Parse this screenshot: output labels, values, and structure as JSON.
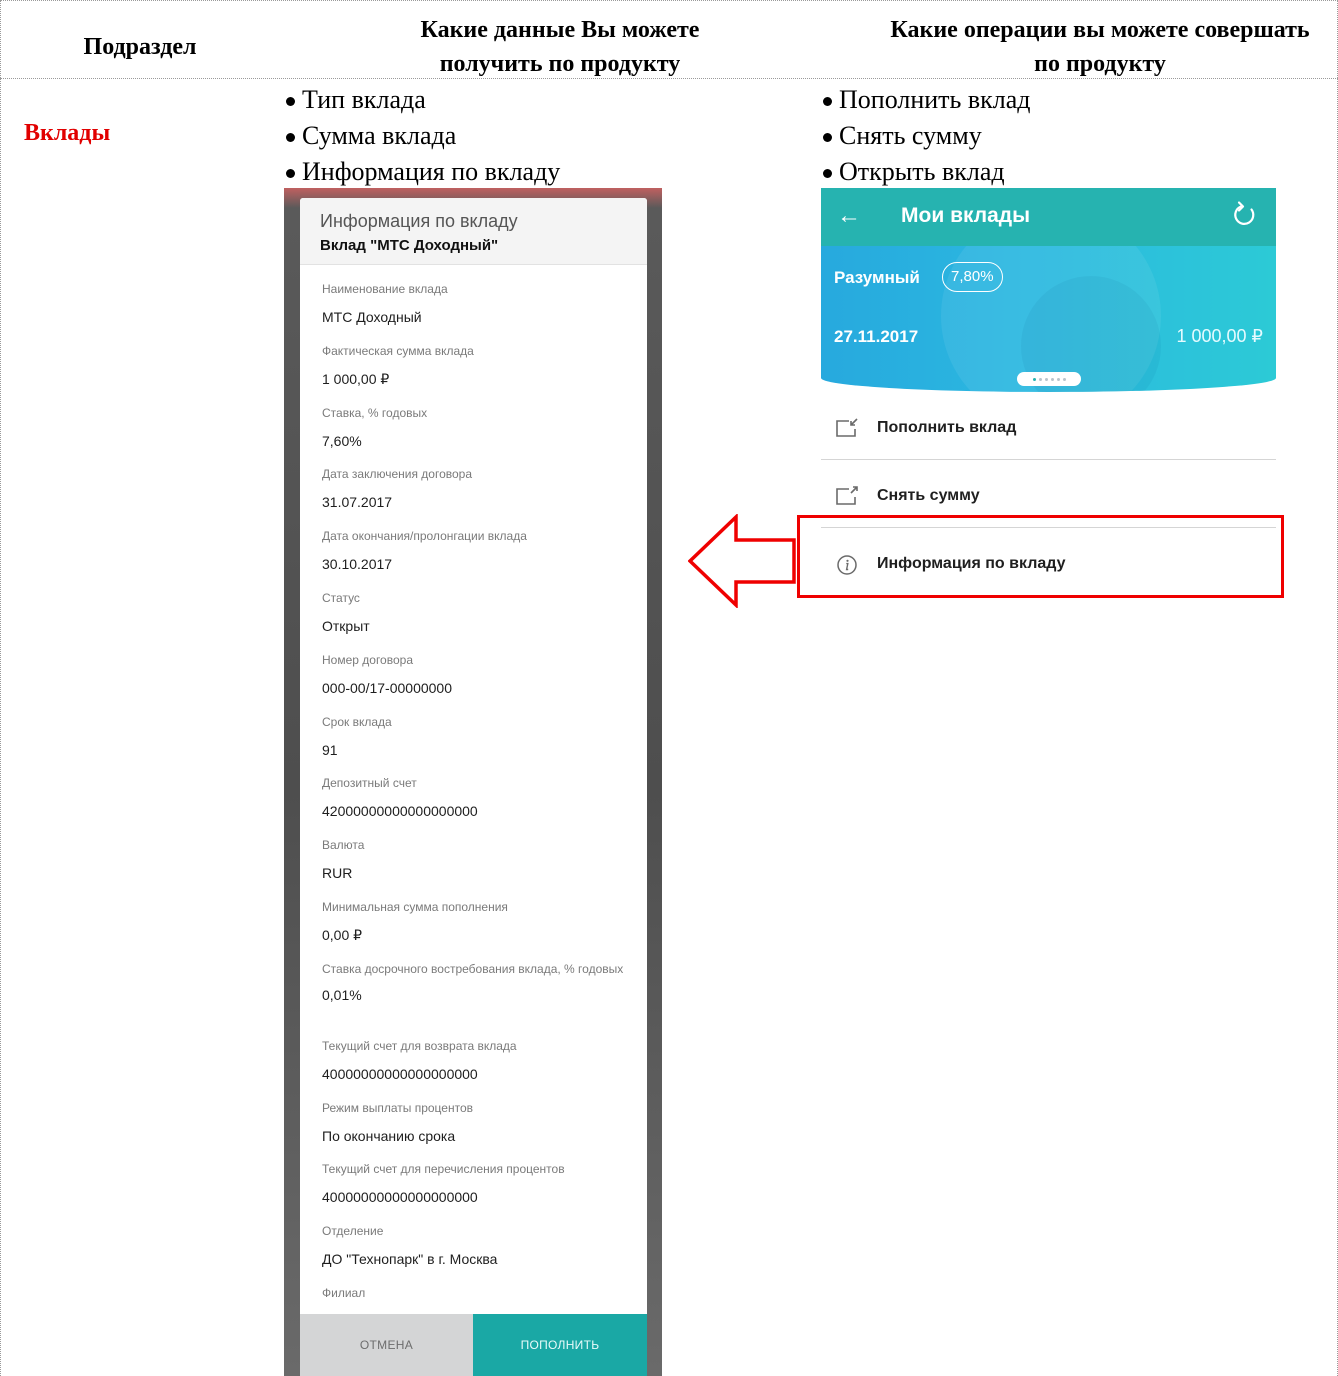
{
  "table": {
    "col1_header": "Подраздел",
    "col2_header": "Какие данные Вы можете получить по продукту",
    "col3_header": "Какие операции вы можете совершать по продукту",
    "section_name": "Вклады",
    "data_items": [
      "Тип вклада",
      "Сумма вклада",
      "Информация по вкладу"
    ],
    "operation_items": [
      "Пополнить вклад",
      "Снять сумму",
      "Открыть вклад"
    ]
  },
  "dialog": {
    "title": "Информация по вкладу",
    "subtitle": "Вклад \"МТС Доходный\"",
    "fields": [
      {
        "label": "Наименование вклада",
        "value": "МТС Доходный"
      },
      {
        "label": "Фактическая сумма вклада",
        "value": "1 000,00 ₽"
      },
      {
        "label": "Ставка, % годовых",
        "value": "7,60%"
      },
      {
        "label": "Дата заключения договора",
        "value": "31.07.2017"
      },
      {
        "label": "Дата окончания/пролонгации вклада",
        "value": "30.10.2017"
      },
      {
        "label": "Статус",
        "value": "Открыт"
      },
      {
        "label": "Номер договора",
        "value": "000-00/17-00000000"
      },
      {
        "label": "Срок вклада",
        "value": "91"
      },
      {
        "label": "Депозитный счет",
        "value": "42000000000000000000"
      },
      {
        "label": "Валюта",
        "value": "RUR"
      },
      {
        "label": "Минимальная сумма пополнения",
        "value": "0,00 ₽"
      },
      {
        "label": "Ставка досрочного востребования вклада, % годовых",
        "value": "0,01%"
      },
      {
        "label": "Текущий счет для возврата вклада",
        "value": "40000000000000000000"
      },
      {
        "label": "Режим выплаты процентов",
        "value": "По окончанию срока"
      },
      {
        "label": "Текущий счет для перечисления процентов",
        "value": "40000000000000000000"
      },
      {
        "label": "Отделение",
        "value": "ДО \"Технопарк\" в г. Москва"
      },
      {
        "label": "Филиал",
        "value": ""
      }
    ],
    "cancel_label": "ОТМЕНА",
    "fill_label": "ПОПОЛНИТЬ"
  },
  "app": {
    "title": "Мои вклады",
    "card": {
      "name": "Разумный",
      "rate": "7,80%",
      "date": "27.11.2017",
      "amount": "1 000,00 ₽"
    },
    "actions": [
      "Пополнить вклад",
      "Снять сумму",
      "Информация по вкладу"
    ]
  },
  "colors": {
    "section_red": "#e10000",
    "teal": "#26b3b0",
    "highlight_red": "#ef0000"
  }
}
